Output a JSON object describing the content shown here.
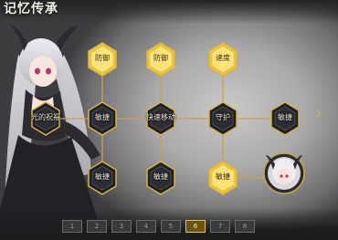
{
  "page": {
    "title": "记忆传承"
  },
  "accent": "#e1b730",
  "line_color": "#c9a24a",
  "nodes": {
    "n_top1": {
      "label": "防御",
      "style": "gold"
    },
    "n_top2": {
      "label": "防御",
      "style": "gold"
    },
    "n_top3": {
      "label": "速度",
      "style": "gold"
    },
    "n_mid0": {
      "label": "光的祝福",
      "style": "dark"
    },
    "n_mid1": {
      "label": "敏捷",
      "style": "dark"
    },
    "n_mid2": {
      "label": "快速移动",
      "style": "dark"
    },
    "n_mid3": {
      "label": "守护",
      "style": "dark"
    },
    "n_mid4": {
      "label": "敏捷",
      "style": "dark"
    },
    "n_bot1": {
      "label": "敏捷",
      "style": "dark"
    },
    "n_bot2": {
      "label": "敏捷",
      "style": "dark"
    },
    "n_bot3": {
      "label": "敏捷",
      "style": "gold"
    }
  },
  "tabs": [
    "1",
    "2",
    "3",
    "4",
    "5",
    "6",
    "7",
    "8"
  ],
  "active_tab": 5,
  "icons": {
    "next": "chevron-right-icon",
    "portrait": "character-portrait"
  }
}
